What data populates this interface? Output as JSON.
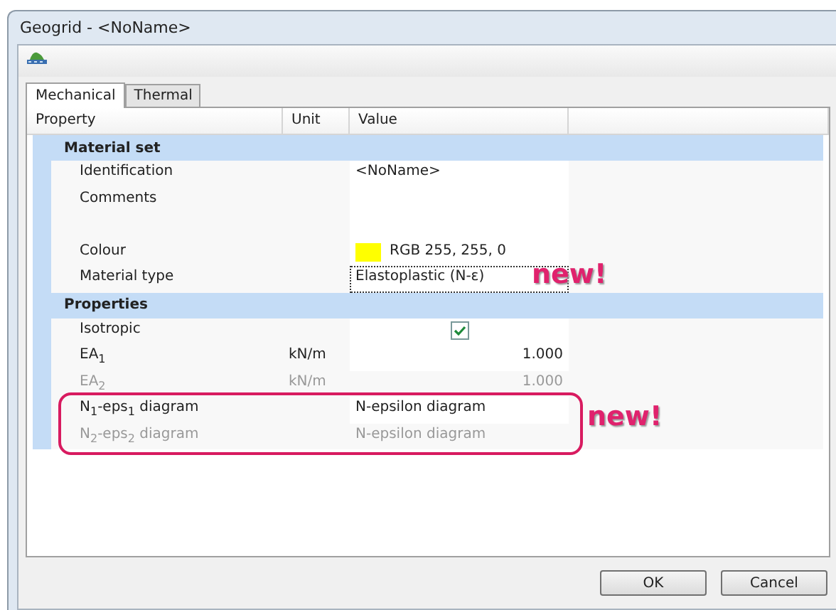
{
  "window": {
    "title": "Geogrid - <NoName>"
  },
  "tabs": [
    {
      "label": "Mechanical",
      "selected": true
    },
    {
      "label": "Thermal",
      "selected": false
    }
  ],
  "columns": [
    "Property",
    "Unit",
    "Value"
  ],
  "groups": [
    {
      "title": "Material set",
      "rows": [
        {
          "kind": "text",
          "property": "Identification",
          "value": "<NoName>",
          "disabled": false
        },
        {
          "kind": "multiline",
          "property": "Comments",
          "disabled": false
        },
        {
          "kind": "colour",
          "property": "Colour",
          "value": "RGB 255, 255, 0",
          "color": "#ffff00",
          "disabled": false
        },
        {
          "kind": "text",
          "property": "Material type",
          "value": "Elastoplastic (N-ε)",
          "disabled": false,
          "focused": true,
          "note": "new!"
        }
      ]
    },
    {
      "title": "Properties",
      "rows": [
        {
          "kind": "checkbox",
          "property": "Isotropic",
          "checked": true,
          "disabled": false
        },
        {
          "kind": "number",
          "property": "EA$_{1}$",
          "unit": "kN/m",
          "value": "1.000",
          "disabled": false
        },
        {
          "kind": "number",
          "property": "EA$_{2}$",
          "unit": "kN/m",
          "value": "1.000",
          "disabled": true
        },
        {
          "kind": "text",
          "property": "N$_{1}$-eps$_{1}$ diagram",
          "value": "N-epsilon diagram",
          "disabled": false,
          "highlight": true
        },
        {
          "kind": "text",
          "property": "N$_{2}$-eps$_{2}$ diagram",
          "value": "N-epsilon diagram",
          "disabled": true,
          "highlight": true
        }
      ]
    }
  ],
  "highlight_note": "new!",
  "buttons": [
    "OK",
    "Cancel"
  ]
}
